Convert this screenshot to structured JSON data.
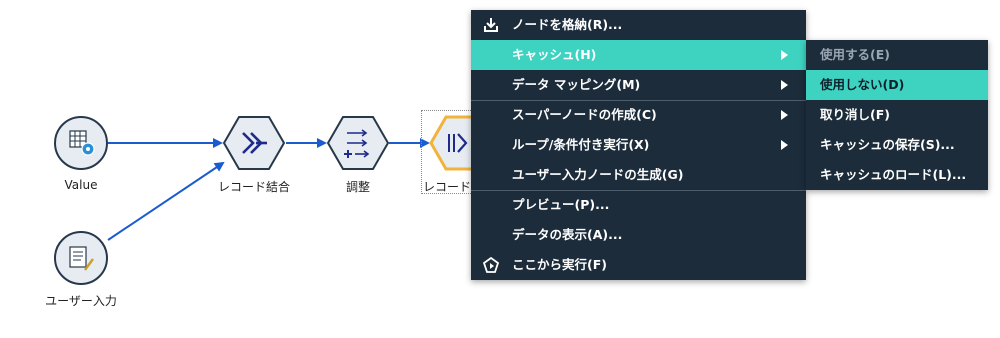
{
  "nodes": {
    "value": {
      "label": "Value"
    },
    "merge": {
      "label": "レコード結合"
    },
    "adjust": {
      "label": "調整"
    },
    "selected": {
      "label": "レコード"
    },
    "user_input": {
      "label": "ユーザー入力"
    }
  },
  "context_menu": {
    "items": [
      {
        "label": "ノードを格納(R)...",
        "icon": "download-icon"
      },
      {
        "label": "キャッシュ(H)",
        "submenu": true,
        "highlighted": true
      },
      {
        "label": "データ マッピング(M)",
        "submenu": true
      },
      {
        "label": "スーパーノードの作成(C)",
        "submenu": true
      },
      {
        "label": "ループ/条件付き実行(X)",
        "submenu": true
      },
      {
        "label": "ユーザー入力ノードの生成(G)"
      },
      {
        "label": "プレビュー(P)..."
      },
      {
        "label": "データの表示(A)..."
      },
      {
        "label": "ここから実行(F)",
        "icon": "run-from-here-icon"
      }
    ]
  },
  "cache_submenu": {
    "items": [
      {
        "label": "使用する(E)",
        "disabled": true
      },
      {
        "label": "使用しない(D)",
        "highlighted": true
      },
      {
        "label": "取り消し(F)"
      },
      {
        "label": "キャッシュの保存(S)..."
      },
      {
        "label": "キャッシュのロード(L)..."
      }
    ]
  },
  "colors": {
    "menu_bg": "#1c2c3b",
    "highlight": "#3ed3c1",
    "arrow": "#1a5ccf",
    "node_fill": "#e6ecf1",
    "node_stroke": "#27384a",
    "selected_stroke": "#f0b33c"
  }
}
